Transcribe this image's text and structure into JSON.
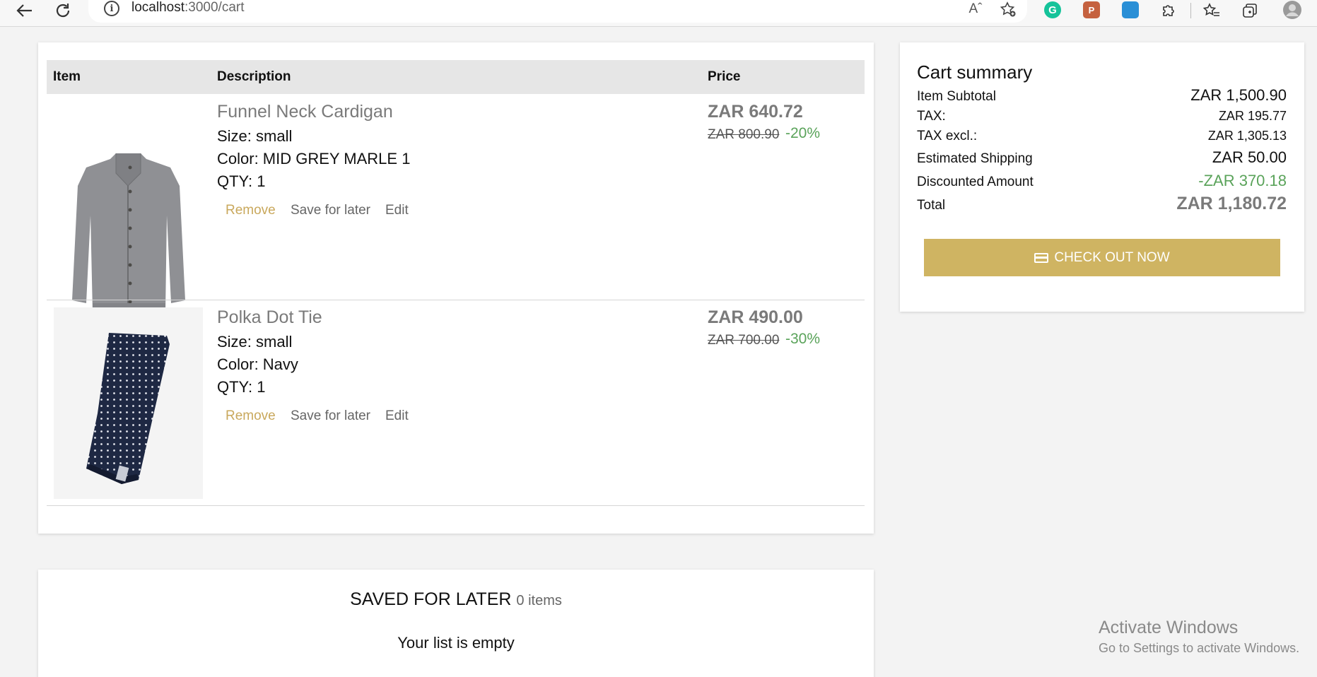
{
  "browser": {
    "url_host": "localhost",
    "url_path": ":3000/cart",
    "info_glyph": "i",
    "read_aloud_glyph": "Aˆ"
  },
  "table": {
    "headers": {
      "item": "Item",
      "description": "Description",
      "price": "Price"
    }
  },
  "items": [
    {
      "name": "Funnel Neck Cardigan",
      "size": "Size: small",
      "color": "Color: MID GREY MARLE 1",
      "qty": "QTY: 1",
      "price": "ZAR 640.72",
      "old_price": "ZAR 800.90",
      "discount": "-20%",
      "actions": {
        "remove": "Remove",
        "save": "Save for later",
        "edit": "Edit"
      }
    },
    {
      "name": "Polka Dot Tie",
      "size": "Size: small",
      "color": "Color: Navy",
      "qty": "QTY: 1",
      "price": "ZAR 490.00",
      "old_price": "ZAR 700.00",
      "discount": "-30%",
      "actions": {
        "remove": "Remove",
        "save": "Save for later",
        "edit": "Edit"
      }
    }
  ],
  "summary": {
    "title": "Cart summary",
    "rows": [
      {
        "label": "Item Subtotal",
        "value": "ZAR 1,500.90"
      },
      {
        "label": "TAX:",
        "value": "ZAR 195.77"
      },
      {
        "label": "TAX excl.:",
        "value": "ZAR 1,305.13"
      },
      {
        "label": "Estimated Shipping",
        "value": "ZAR 50.00"
      },
      {
        "label": "Discounted Amount",
        "value": "-ZAR 370.18"
      },
      {
        "label": "Total",
        "value": "ZAR 1,180.72"
      }
    ],
    "checkout_label": "CHECK OUT NOW"
  },
  "saved": {
    "title": "SAVED FOR LATER",
    "count": "0 items",
    "empty_message": "Your list is empty"
  },
  "watermark": {
    "line1": "Activate Windows",
    "line2": "Go to Settings to activate Windows."
  },
  "colors": {
    "accent_gold": "#cfb462",
    "remove_link": "#c9a85c",
    "discount_green": "#5aa35a"
  }
}
